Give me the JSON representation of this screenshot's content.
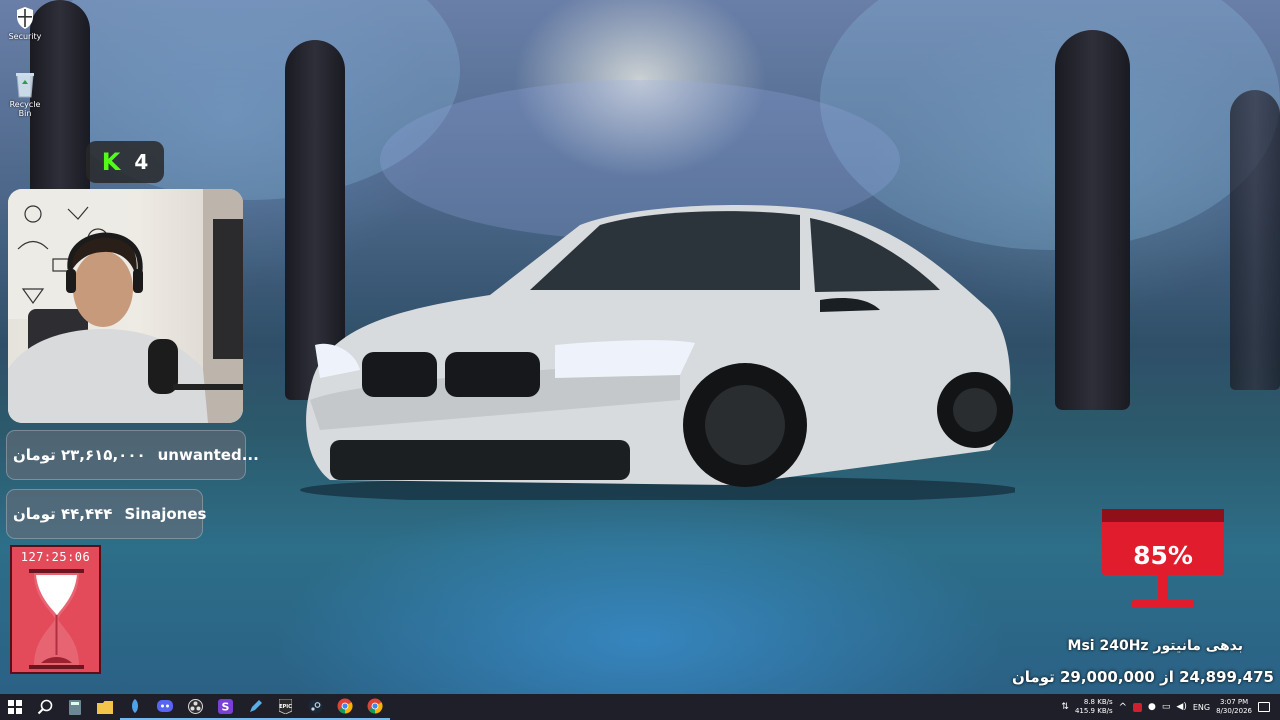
{
  "desktop": {
    "icons": [
      {
        "label": "Security",
        "icon": "shield-icon"
      },
      {
        "label": "Recycle Bin",
        "icon": "recycle-bin-icon"
      }
    ]
  },
  "stream": {
    "kick_viewers": "4",
    "donations": [
      {
        "amount": "۲۳,۶۱۵,۰۰۰ تومان",
        "name": "unwanted..."
      },
      {
        "amount": "۴۴,۴۴۴ تومان",
        "name": "Sinajones"
      }
    ],
    "timer": "127:25:06",
    "goal": {
      "percent": "85%",
      "title": "بدهی مانیتور Msi 240Hz",
      "amount": "24,899,475 از 29,000,000 تومان"
    }
  },
  "taskbar": {
    "buttons": [
      "windows-start-icon",
      "search-icon",
      "calculator-icon",
      "folder-icon",
      "app-icon",
      "discord-icon",
      "obs-icon",
      "s-app-icon",
      "pen-app-icon",
      "epic-games-icon",
      "steam-icon",
      "chrome-icon",
      "chrome-icon-2"
    ],
    "language": "ENG",
    "net_up": "8.8 KB/s",
    "net_down": "415.9 KB/s",
    "time": "3:07 PM",
    "date": "8/30/2026"
  },
  "colors": {
    "kick_green": "#53fc18",
    "goal_red": "#e01c2d",
    "timer_red": "#e34b5b",
    "taskbar_bg": "#1f1f2a"
  }
}
